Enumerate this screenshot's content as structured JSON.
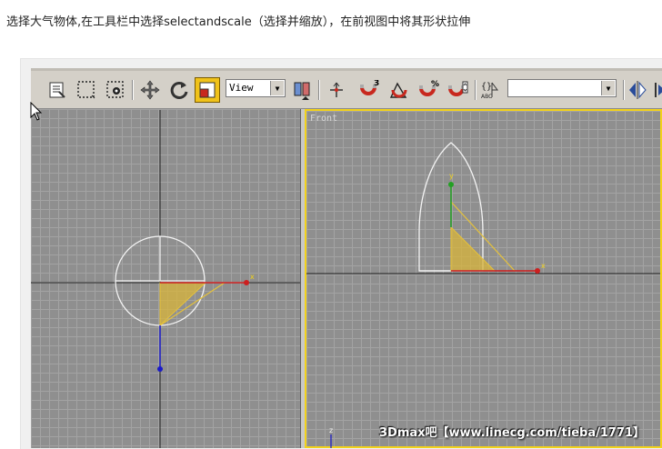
{
  "instruction": "选择大气物体,在工具栏中选择selectandscale（选择并缩放），在前视图中将其形状拉伸",
  "toolbar": {
    "icons": [
      "select-by-name-icon",
      "rectangular-selection-icon",
      "window-crossing-icon",
      "move-icon",
      "rotate-icon",
      "scale-icon",
      "reference-coordinate-dropdown",
      "pivot-center-icon",
      "mirror-axis-icon",
      "snap-3d-icon",
      "angle-snap-icon",
      "percent-snap-icon",
      "spinner-snap-icon",
      "named-selection-icon",
      "mirror-icon",
      "align-icon"
    ],
    "coord_system": "View",
    "snap_label": "3",
    "percent_label": "%",
    "named_selection_value": "",
    "abc_label": "ABC"
  },
  "viewports": {
    "left": {
      "label": ""
    },
    "right": {
      "label": "Front"
    }
  },
  "axis_labels": {
    "x": "x",
    "y": "y",
    "z": "z"
  },
  "watermark": "3Dmax吧【www.linecg.com/tieba/1771】",
  "colors": {
    "grid": "#a3a3a3",
    "viewport_bg": "#8f8f8f",
    "active_border": "#f2d21a",
    "gizmo_fill": "#d8b43a",
    "x_axis": "#cc1f1f",
    "y_axis": "#22a022",
    "z_axis": "#1a1ac8"
  }
}
